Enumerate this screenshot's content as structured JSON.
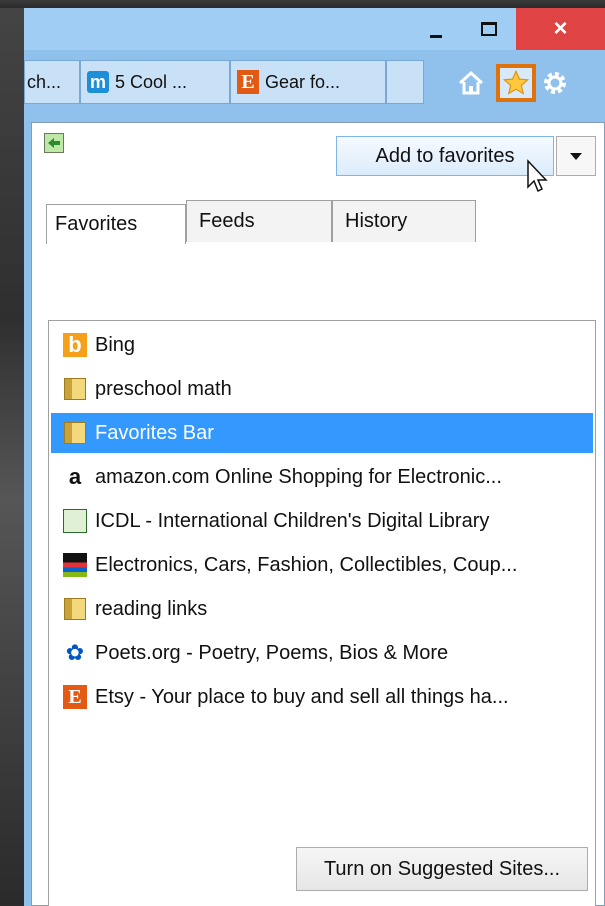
{
  "window": {
    "controls": {
      "minimize": "minimize",
      "maximize": "maximize",
      "close": "×"
    }
  },
  "tabs": [
    {
      "label": "ch...",
      "icon": "none"
    },
    {
      "label": "5 Cool ...",
      "icon": "m-site-icon"
    },
    {
      "label": "Gear fo...",
      "icon": "etsy-icon"
    },
    {
      "label": "",
      "icon": "none"
    }
  ],
  "toolbar": {
    "home_icon": "home-icon",
    "favorites_icon": "star-icon",
    "tools_icon": "gear-icon",
    "accent": "#e0720c"
  },
  "favorites_pane": {
    "add_button": "Add to favorites",
    "tabs": [
      "Favorites",
      "Feeds",
      "History"
    ],
    "items": [
      {
        "label": "Bing",
        "icon": "bing-icon"
      },
      {
        "label": "preschool math",
        "icon": "folder-icon"
      },
      {
        "label": "Favorites Bar",
        "icon": "folder-icon",
        "selected": true
      },
      {
        "label": "amazon.com Online Shopping for Electronic...",
        "icon": "amazon-icon"
      },
      {
        "label": "ICDL - International Children's Digital Library",
        "icon": "icdl-icon"
      },
      {
        "label": "Electronics, Cars, Fashion, Collectibles, Coup...",
        "icon": "ebay-icon"
      },
      {
        "label": "reading links",
        "icon": "folder-icon"
      },
      {
        "label": "Poets.org - Poetry, Poems, Bios & More",
        "icon": "poets-icon"
      },
      {
        "label": "Etsy - Your place to buy and sell all things ha...",
        "icon": "etsy-icon"
      }
    ],
    "suggested_button": "Turn on Suggested Sites...",
    "selection_color": "#3399ff"
  }
}
